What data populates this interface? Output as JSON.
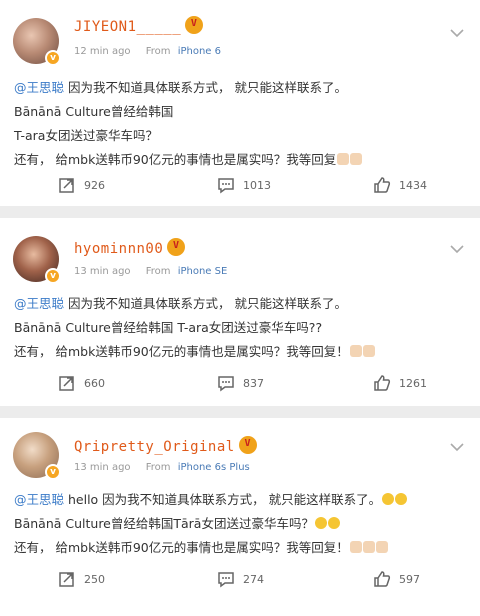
{
  "posts": [
    {
      "username": "JIYEON1_____",
      "time": "12 min ago",
      "from_label": "From",
      "device": "iPhone 6",
      "mention": "@王思聪",
      "line1": " 因为我不知道具体联系方式， 就只能这样联系了。",
      "line2": "Bānānā Culture曾经给韩国",
      "line3": "T-ara女团送过豪华车吗？",
      "line4": "还有， 给mbk送韩币90亿元的事情也是属实吗？我等回复",
      "emoji_count": 2,
      "shares": "926",
      "comments": "1013",
      "likes": "1434"
    },
    {
      "username": "hyominnn00",
      "time": "13 min ago",
      "from_label": "From",
      "device": "iPhone SE",
      "mention": "@王思聪",
      "line1": " 因为我不知道具体联系方式， 就只能这样联系了。",
      "line2": "Bānānā Culture曾经给韩国 T-ara女团送过豪华车吗??",
      "line3": "还有， 给mbk送韩币90亿元的事情也是属实吗？我等回复！",
      "emoji_count": 2,
      "shares": "660",
      "comments": "837",
      "likes": "1261"
    },
    {
      "username": "Qripretty_Original",
      "time": "13 min ago",
      "from_label": "From",
      "device": "iPhone 6s Plus",
      "mention": "@王思聪",
      "line1": " hello 因为我不知道具体联系方式， 就只能这样联系了。",
      "line2": "Bānānā Culture曾经给韩国Tārā女团送过豪华车吗？",
      "line3": "还有， 给mbk送韩币90亿元的事情也是属实吗？我等回复！",
      "emoji_count": 3,
      "shares": "250",
      "comments": "274",
      "likes": "597"
    }
  ],
  "icons": {
    "share": "share-icon",
    "comment": "comment-icon",
    "like": "like-icon",
    "more": "chevron-down-icon"
  },
  "colors": {
    "username": "#e05a1a",
    "mention": "#3b7bc8",
    "device": "#4a7bb6",
    "vip_badge": "#f0a21a"
  }
}
